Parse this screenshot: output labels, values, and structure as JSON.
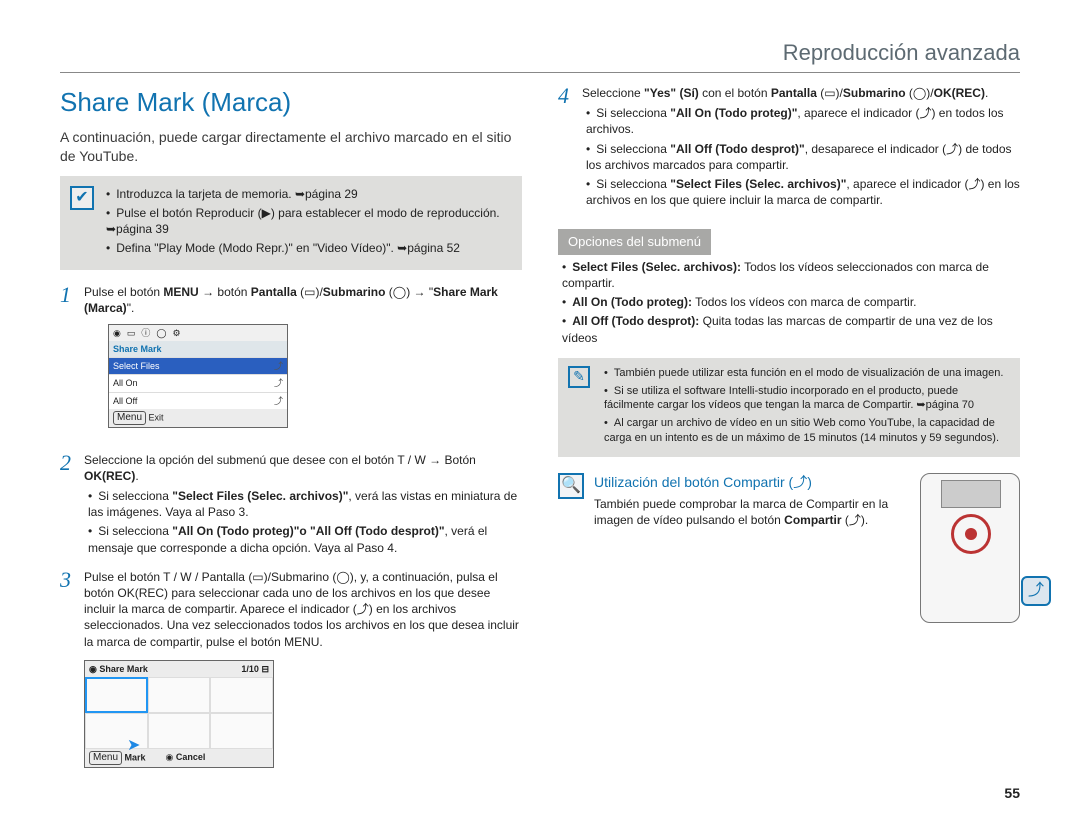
{
  "header": {
    "section": "Reproducción avanzada"
  },
  "title": "Share Mark (Marca)",
  "intro": "A continuación, puede cargar directamente el archivo marcado en el sitio de YouTube.",
  "pre": {
    "items": [
      "Introduzca la tarjeta de memoria. ➥página 29",
      "Pulse el botón Reproducir (▶) para establecer el modo de reproducción. ➥página 39",
      "Defina \"Play Mode (Modo Repr.)\" en \"Video Vídeo)\". ➥página 52"
    ]
  },
  "steps_left": {
    "s1": {
      "num": "1",
      "text_a": "Pulse el botón ",
      "text_b": "MENU",
      "text_c": " → botón ",
      "text_d": "Pantalla",
      "text_e": " (▭)/",
      "text_f": "Submarino",
      "text_g": " (◯) → \"",
      "text_h": "Share Mark (Marca)",
      "text_i": "\"."
    },
    "s2": {
      "num": "2",
      "text": "Seleccione la opción del submenú que desee con el botón T / W → Botón ",
      "bold": "OK(REC)",
      "after": ".",
      "bul1_a": "Si selecciona ",
      "bul1_b": "\"Select Files (Selec. archivos)\"",
      "bul1_c": ", verá las vistas en miniatura de las imágenes. Vaya al Paso 3.",
      "bul2_a": "Si selecciona ",
      "bul2_b": "\"All On (Todo proteg)\"o \"All Off (Todo desprot)\"",
      "bul2_c": ", verá el mensaje que corresponde a dicha opción. Vaya al Paso 4."
    },
    "s3": {
      "num": "3",
      "text": "Pulse el botón T / W / Pantalla (▭)/Submarino (◯), y, a continuación, pulsa el botón OK(REC) para seleccionar cada uno de los archivos en los que desee incluir la marca de compartir. Aparece el indicador (⤴) en los archivos seleccionados. Una vez seleccionados todos los archivos en los que desea incluir la marca de compartir, pulse el botón MENU."
    }
  },
  "steps_right": {
    "s4": {
      "num": "4",
      "text_a": "Seleccione ",
      "text_b": "\"Yes\" (Sí)",
      "text_c": " con el botón ",
      "text_d": "Pantalla",
      "text_e": " (▭)/",
      "text_f": "Submarino",
      "text_g": " (◯)/",
      "text_h": "OK(REC)",
      "text_i": ".",
      "bul1_a": "Si selecciona ",
      "bul1_b": "\"All On (Todo proteg)\"",
      "bul1_c": ", aparece el indicador (⤴) en todos los archivos.",
      "bul2_a": "Si selecciona ",
      "bul2_b": "\"All Off (Todo desprot)\"",
      "bul2_c": ", desaparece el indicador (⤴) de todos los archivos marcados para compartir.",
      "bul3_a": "Si selecciona ",
      "bul3_b": "\"Select Files (Selec. archivos)\"",
      "bul3_c": ", aparece el indicador (⤴) en los archivos en los que quiere incluir la marca de compartir."
    }
  },
  "sub": {
    "heading": "Opciones del submenú",
    "i1_b": "Select Files (Selec. archivos):",
    "i1_t": " Todos los vídeos seleccionados con marca de compartir.",
    "i2_b": "All On (Todo proteg):",
    "i2_t": " Todos los vídeos con marca de compartir.",
    "i3_b": "All Off (Todo desprot):",
    "i3_t": " Quita todas las marcas de compartir de una vez de los vídeos"
  },
  "tips": {
    "t1": "También puede utilizar esta función en el modo de visualización de una imagen.",
    "t2": "Si se utiliza el software Intelli-studio incorporado en el producto, puede fácilmente cargar los vídeos que tengan la marca de Compartir. ➥página 70",
    "t3": "Al cargar un archivo de vídeo en un sitio Web como YouTube, la capacidad de carga en un intento es de un máximo de 15 minutos (14 minutos y 59 segundos)."
  },
  "q": {
    "title": "Utilización del botón Compartir (⤴)",
    "text_a": "También puede comprobar la marca de Compartir en la imagen de vídeo pulsando el botón ",
    "text_b": "Compartir",
    "text_c": " (⤴)."
  },
  "lcd1": {
    "header": "Share Mark",
    "row1": "Select Files",
    "row2": "All On",
    "row3": "All Off",
    "exit": "Exit",
    "menu": "Menu"
  },
  "lcd2": {
    "title": "Share Mark",
    "count": "1/10",
    "mark": "Mark",
    "cancel": "Cancel",
    "menu": "Menu"
  },
  "pagenum": "55"
}
